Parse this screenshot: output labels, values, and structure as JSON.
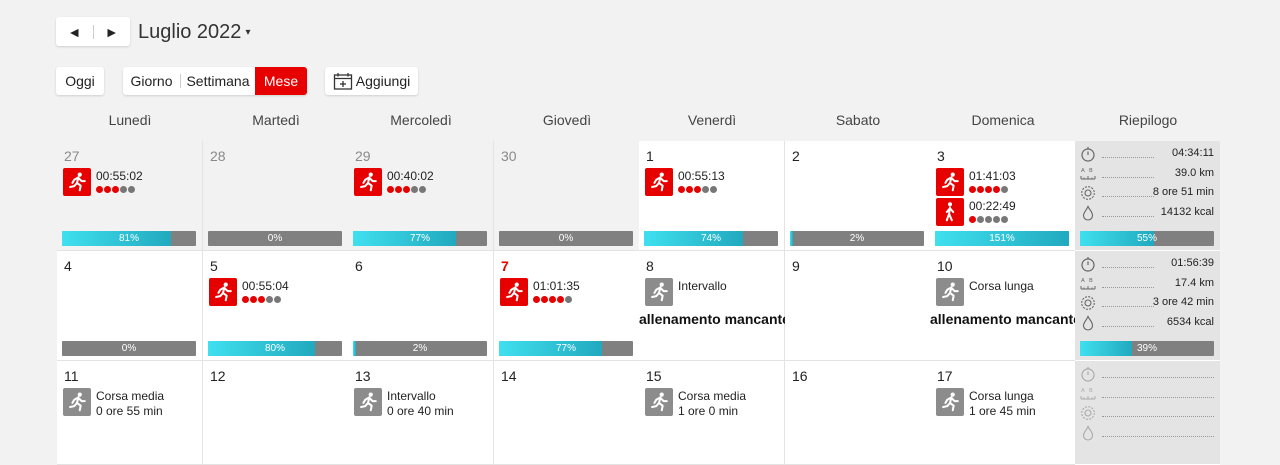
{
  "header": {
    "month_label": "Luglio 2022",
    "prev_icon": "prev-arrow-icon",
    "next_icon": "next-arrow-icon",
    "prev_glyph": "◄",
    "next_glyph": "►",
    "caret": "▾"
  },
  "toolbar": {
    "today": "Oggi",
    "views": [
      "Giorno",
      "Settimana",
      "Mese"
    ],
    "active_view": "Mese",
    "add": "Aggiungi",
    "add_icon": "calendar-add-icon"
  },
  "weekdays": [
    "Lunedì",
    "Martedì",
    "Mercoledì",
    "Giovedì",
    "Venerdì",
    "Sabato",
    "Domenica",
    "Riepilogo"
  ],
  "colors": {
    "accent": "#e60000",
    "progress": "#2fc4d8",
    "bar_gray": "#808080"
  },
  "weeks": [
    {
      "days": [
        {
          "n": "27",
          "other": true,
          "acts": [
            {
              "type": "run",
              "color": "red",
              "time": "00:55:02",
              "dots": 3
            }
          ],
          "progress": 81,
          "pct": "81%"
        },
        {
          "n": "28",
          "other": true,
          "acts": [],
          "progress": 0,
          "pct": "0%"
        },
        {
          "n": "29",
          "other": true,
          "acts": [
            {
              "type": "run",
              "color": "red",
              "time": "00:40:02",
              "dots": 3
            }
          ],
          "progress": 77,
          "pct": "77%"
        },
        {
          "n": "30",
          "other": true,
          "acts": [],
          "progress": 0,
          "pct": "0%"
        },
        {
          "n": "1",
          "acts": [
            {
              "type": "run",
              "color": "red",
              "time": "00:55:13",
              "dots": 3
            }
          ],
          "progress": 74,
          "pct": "74%"
        },
        {
          "n": "2",
          "acts": [],
          "progress": 2,
          "pct": "2%"
        },
        {
          "n": "3",
          "acts": [
            {
              "type": "run",
              "color": "red",
              "time": "01:41:03",
              "dots": 4
            },
            {
              "type": "walk",
              "color": "red",
              "time": "00:22:49",
              "dots": 1
            }
          ],
          "progress": 151,
          "pct": "151%"
        }
      ],
      "summary": {
        "time": "04:34:11",
        "distance": "39.0 km",
        "duration": "8 ore 51 min",
        "energy": "14132 kcal",
        "progress": 55,
        "pct": "55%"
      }
    },
    {
      "days": [
        {
          "n": "4",
          "acts": [],
          "progress": 0,
          "pct": "0%"
        },
        {
          "n": "5",
          "acts": [
            {
              "type": "run",
              "color": "red",
              "time": "00:55:04",
              "dots": 3
            }
          ],
          "progress": 80,
          "pct": "80%"
        },
        {
          "n": "6",
          "acts": [],
          "progress": 2,
          "pct": "2%"
        },
        {
          "n": "7",
          "today": true,
          "acts": [
            {
              "type": "run",
              "color": "red",
              "time": "01:01:35",
              "dots": 4
            }
          ],
          "progress": 77,
          "pct": "77%"
        },
        {
          "n": "8",
          "acts": [
            {
              "type": "run",
              "color": "gray",
              "time": "Intervallo"
            }
          ],
          "missing": "allenamento mancante"
        },
        {
          "n": "9",
          "acts": []
        },
        {
          "n": "10",
          "acts": [
            {
              "type": "run",
              "color": "gray",
              "time": "Corsa lunga"
            }
          ],
          "missing": "allenamento mancante"
        }
      ],
      "summary": {
        "time": "01:56:39",
        "distance": "17.4 km",
        "duration": "3 ore 42 min",
        "energy": "6534 kcal",
        "progress": 39,
        "pct": "39%"
      }
    },
    {
      "days": [
        {
          "n": "11",
          "acts": [
            {
              "type": "run",
              "color": "gray",
              "time": "Corsa media",
              "sub": "0 ore 55 min"
            }
          ]
        },
        {
          "n": "12",
          "acts": []
        },
        {
          "n": "13",
          "acts": [
            {
              "type": "run",
              "color": "gray",
              "time": "Intervallo",
              "sub": "0 ore 40 min"
            }
          ]
        },
        {
          "n": "14",
          "acts": []
        },
        {
          "n": "15",
          "acts": [
            {
              "type": "run",
              "color": "gray",
              "time": "Corsa media",
              "sub": "1 ore 0 min"
            }
          ]
        },
        {
          "n": "16",
          "acts": []
        },
        {
          "n": "17",
          "acts": [
            {
              "type": "run",
              "color": "gray",
              "time": "Corsa lunga",
              "sub": "1 ore 45 min"
            }
          ]
        }
      ],
      "summary": {
        "time": "",
        "distance": "",
        "duration": "",
        "energy": "",
        "empty": true
      }
    }
  ]
}
